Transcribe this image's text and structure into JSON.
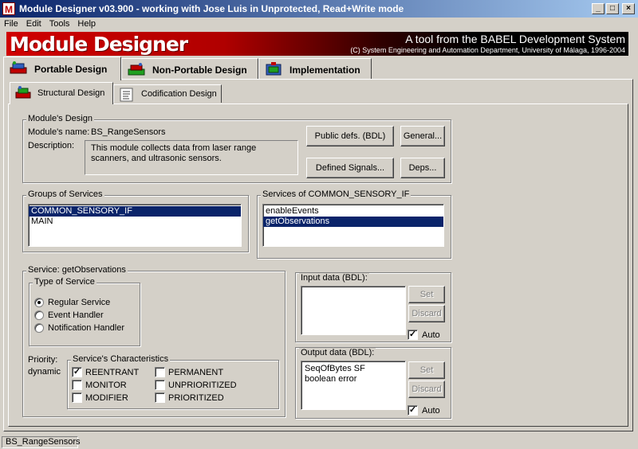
{
  "window": {
    "title": "Module Designer v03.900 - working with Jose Luis in Unprotected, Read+Write mode",
    "icon_letter": "M"
  },
  "menu": [
    {
      "label": "File"
    },
    {
      "label": "Edit"
    },
    {
      "label": "Tools"
    },
    {
      "label": "Help"
    }
  ],
  "banner": {
    "logo": "Module Designer",
    "tagline": "A tool from the BABEL Development System",
    "credits": "(C) System Engineering and Automation Department, University of Málaga, 1996-2004"
  },
  "top_tabs": [
    {
      "label": "Portable Design",
      "active": true
    },
    {
      "label": "Non-Portable Design",
      "active": false
    },
    {
      "label": "Implementation",
      "active": false
    }
  ],
  "sub_tabs": [
    {
      "label": "Structural Design",
      "active": true
    },
    {
      "label": "Codification Design",
      "active": false
    }
  ],
  "module_design": {
    "legend": "Module's Design",
    "name_label": "Module's name:",
    "name_value": "BS_RangeSensors",
    "description_label": "Description:",
    "description_value": "This module collects data from laser range scanners, and ultrasonic sensors.",
    "public_defs_button": "Public defs. (BDL)",
    "general_button": "General...",
    "defined_signals_button": "Defined Signals...",
    "deps_button": "Deps..."
  },
  "groups_of_services": {
    "legend": "Groups of Services",
    "items": [
      "COMMON_SENSORY_IF",
      "MAIN"
    ],
    "selected_index": 0
  },
  "services_of_group": {
    "legend": "Services of COMMON_SENSORY_IF",
    "items": [
      "enableEvents",
      "getObservations"
    ],
    "selected_index": 1
  },
  "service": {
    "legend": "Service: getObservations",
    "type_legend": "Type of Service",
    "types": [
      {
        "label": "Regular Service",
        "checked": true
      },
      {
        "label": "Event Handler",
        "checked": false
      },
      {
        "label": "Notification Handler",
        "checked": false
      }
    ],
    "priority_label": "Priority:",
    "priority_value": "dynamic",
    "characteristics_legend": "Service's Characteristics",
    "characteristics": [
      {
        "label": "REENTRANT",
        "checked": true
      },
      {
        "label": "PERMANENT",
        "checked": false
      },
      {
        "label": "MONITOR",
        "checked": false
      },
      {
        "label": "UNPRIORITIZED",
        "checked": false
      },
      {
        "label": "MODIFIER",
        "checked": false
      },
      {
        "label": "PRIORITIZED",
        "checked": false
      }
    ]
  },
  "input_data": {
    "legend": "Input data (BDL):",
    "lines": [],
    "set_button": "Set",
    "discard_button": "Discard",
    "auto_label": "Auto",
    "auto_checked": true
  },
  "output_data": {
    "legend": "Output data (BDL):",
    "lines": [
      "SeqOfBytes SF",
      "boolean error"
    ],
    "set_button": "Set",
    "discard_button": "Discard",
    "auto_label": "Auto",
    "auto_checked": true
  },
  "status_bar": {
    "text": "BS_RangeSensors"
  },
  "colors": {
    "selection": "#0a246a",
    "banner_red": "#d00000",
    "face": "#d4d0c8"
  }
}
